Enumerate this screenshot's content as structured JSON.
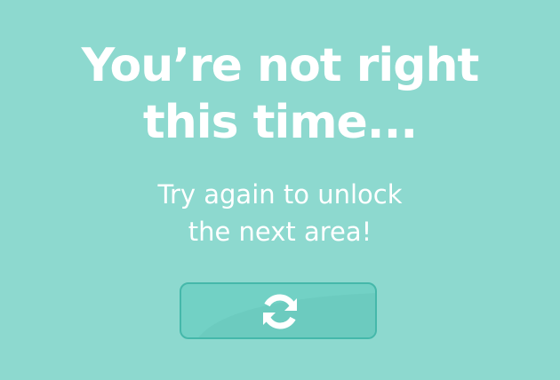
{
  "result": {
    "title_line1": "You’re not right",
    "title_line2": "this time...",
    "message_line1": "Try again to unlock",
    "message_line2": "the next area!"
  },
  "retry_button": {
    "icon": "refresh-icon"
  },
  "colors": {
    "background": "#8dd9cf",
    "button_fill": "#72d1c5",
    "button_border": "#45b8aa",
    "text": "#ffffff"
  }
}
